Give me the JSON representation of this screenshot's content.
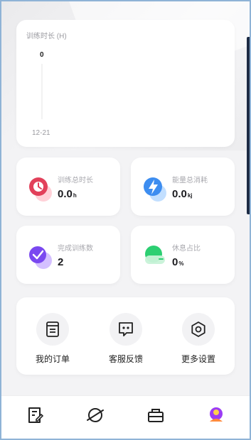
{
  "chart": {
    "title": "训练时长 (H)",
    "y_tick": "0",
    "x_tick": "12-21"
  },
  "chart_data": {
    "type": "line",
    "ylabel": "训练时长 (H)",
    "x": [
      "12-21"
    ],
    "series": [
      {
        "values": [
          0
        ]
      }
    ]
  },
  "stats": [
    {
      "label": "训练总时长",
      "value": "0.0",
      "unit": "h",
      "icon": "clock-icon",
      "color": "#e2405a"
    },
    {
      "label": "能量总消耗",
      "value": "0.0",
      "unit": "kj",
      "icon": "lightning-icon",
      "color": "#3d8df0"
    },
    {
      "label": "完成训练数",
      "value": "2",
      "unit": "",
      "icon": "check-badge-icon",
      "color": "#7a48f0"
    },
    {
      "label": "休息占比",
      "value": "0",
      "unit": "%",
      "icon": "rest-icon",
      "color": "#2ccf72"
    }
  ],
  "menu": [
    {
      "label": "我的订单",
      "icon": "order-list-icon"
    },
    {
      "label": "客服反馈",
      "icon": "chat-feedback-icon"
    },
    {
      "label": "更多设置",
      "icon": "settings-gear-icon"
    }
  ],
  "tabs": [
    {
      "icon": "plan-edit-icon"
    },
    {
      "icon": "discover-planet-icon"
    },
    {
      "icon": "shop-bag-icon"
    },
    {
      "icon": "profile-avatar-icon",
      "color": "#9b3cf5"
    }
  ]
}
